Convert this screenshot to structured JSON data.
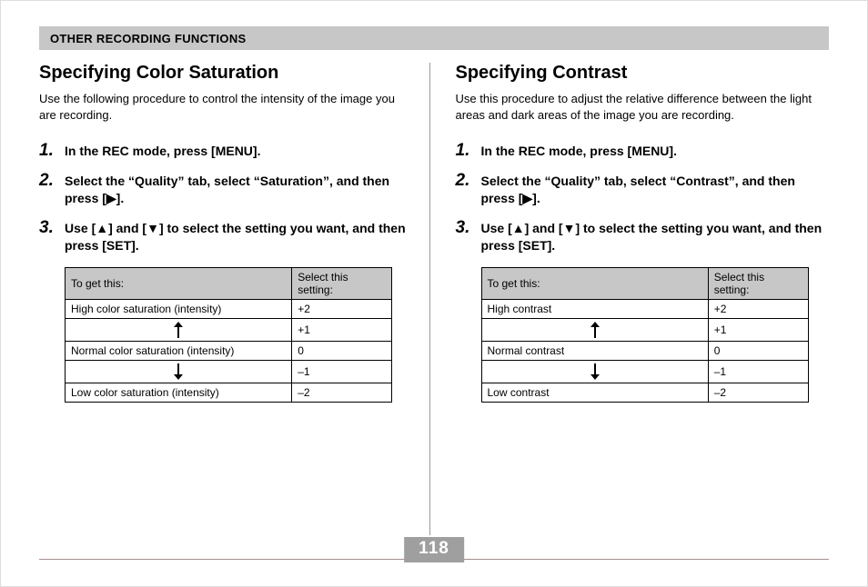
{
  "section_bar": "OTHER RECORDING FUNCTIONS",
  "page_number": "118",
  "left": {
    "heading": "Specifying Color Saturation",
    "intro": "Use the following procedure to control the intensity of the image you are recording.",
    "steps": [
      "In the REC mode, press [MENU].",
      "Select the “Quality” tab, select “Saturation”, and then press [▶].",
      "Use [▲] and [▼] to select the setting you want, and then press [SET]."
    ],
    "table": {
      "header_left": "To get this:",
      "header_right": "Select this setting:",
      "desc_high": "High color saturation (intensity)",
      "desc_normal": "Normal color saturation (intensity)",
      "desc_low": "Low color saturation (intensity)",
      "values": [
        "+2",
        "+1",
        "  0",
        "–1",
        "–2"
      ]
    }
  },
  "right": {
    "heading": "Specifying Contrast",
    "intro": "Use this procedure to adjust the relative difference between the light areas and dark areas of the image you are recording.",
    "steps": [
      "In the REC mode, press [MENU].",
      "Select the “Quality” tab, select “Contrast”, and then press [▶].",
      "Use [▲] and [▼] to select the setting you want, and then press [SET]."
    ],
    "table": {
      "header_left": "To get this:",
      "header_right": "Select this setting:",
      "desc_high": "High contrast",
      "desc_normal": "Normal contrast",
      "desc_low": "Low contrast",
      "values": [
        "+2",
        "+1",
        "  0",
        "–1",
        "–2"
      ]
    }
  }
}
